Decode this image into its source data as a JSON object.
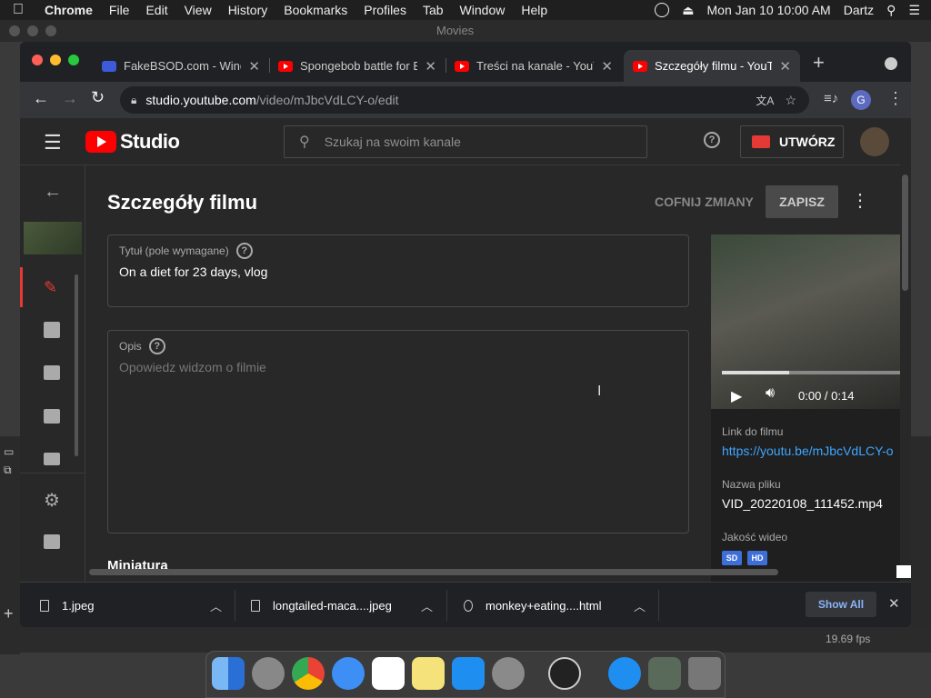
{
  "menubar": {
    "app": "Chrome",
    "items": [
      "File",
      "Edit",
      "View",
      "History",
      "Bookmarks",
      "Profiles",
      "Tab",
      "Window",
      "Help"
    ],
    "datetime": "Mon Jan 10  10:00 AM",
    "user": "Dartz"
  },
  "background_window": {
    "title": "Movies",
    "fps": "19.69 fps"
  },
  "tabs": [
    {
      "label": "FakeBSOD.com - Windows",
      "active": false
    },
    {
      "label": "Spongebob battle for Bikini",
      "active": false
    },
    {
      "label": "Treści na kanale - YouTube",
      "active": false
    },
    {
      "label": "Szczegóły filmu - YouTube",
      "active": true
    }
  ],
  "address": {
    "domain": "studio.youtube.com",
    "path": "/video/mJbcVdLCY-o/edit",
    "profile_initial": "G"
  },
  "studio": {
    "logo": "Studio",
    "search_placeholder": "Szukaj na swoim kanale",
    "create_label": "UTWÓRZ",
    "page_title": "Szczegóły filmu",
    "undo_label": "COFNIJ ZMIANY",
    "save_label": "ZAPISZ",
    "title_field": {
      "label": "Tytuł (pole wymagane)",
      "value": "On a diet for 23 days, vlog"
    },
    "desc_field": {
      "label": "Opis",
      "placeholder": "Opowiedz widzom o filmie"
    },
    "next_section": "Miniatura",
    "preview": {
      "time": "0:00 / 0:14",
      "link_label": "Link do filmu",
      "link_value": "https://youtu.be/mJbcVdLCY-o",
      "filename_label": "Nazwa pliku",
      "filename_value": "VID_20220108_111452.mp4",
      "quality_label": "Jakość wideo",
      "quality_badges": [
        "SD",
        "HD"
      ]
    }
  },
  "downloads": {
    "items": [
      "1.jpeg",
      "longtailed-maca....jpeg",
      "monkey+eating....html"
    ],
    "show_all": "Show All"
  },
  "colors": {
    "youtube_red": "#ff0000",
    "link_blue": "#3ea6ff",
    "accent_red": "#e53935"
  }
}
